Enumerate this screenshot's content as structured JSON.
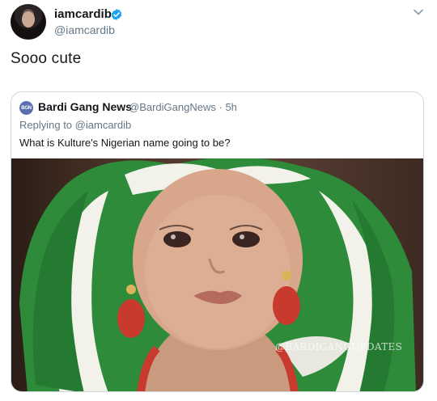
{
  "tweet": {
    "author": {
      "name": "iamcardib",
      "handle": "@iamcardib",
      "verified_icon": "verified-badge-icon",
      "verified_color": "#1da1f2"
    },
    "text": "Sooo cute",
    "menu_icon": "chevron-down-icon"
  },
  "quoted_tweet": {
    "avatar_label": "BGN",
    "name": "Bardi Gang News",
    "handle": "@BardiGangNews",
    "separator": "·",
    "time": "5h",
    "replying_prefix": "Replying to",
    "replying_to": "@iamcardib",
    "text": "What is Kulture's Nigerian name going to be?",
    "image": {
      "watermark": "@BARDIGANGUPDATES"
    }
  },
  "colors": {
    "primary_text": "#14171a",
    "secondary_text": "#657786",
    "border": "#ccd6dd",
    "headwrap_green": "#2e8b3a",
    "headwrap_white": "#f2f2ea",
    "earring_red": "#c83a2e"
  }
}
